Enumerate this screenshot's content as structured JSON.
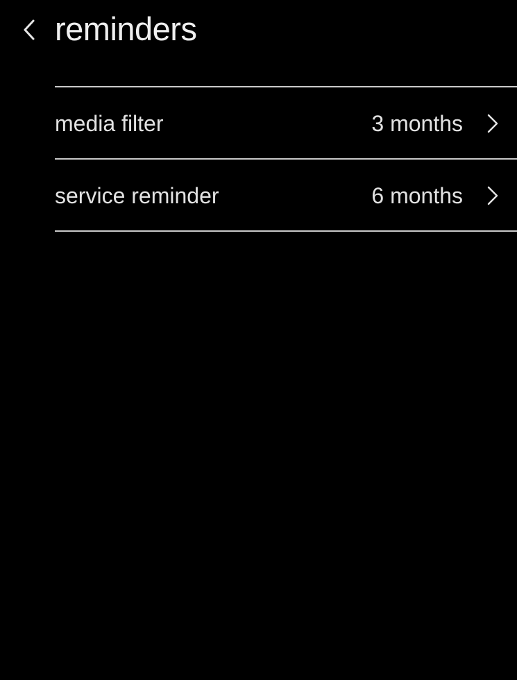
{
  "header": {
    "title": "reminders",
    "back_icon": "chevron-left-icon"
  },
  "reminders": {
    "items": [
      {
        "label": "media filter",
        "value": "3 months",
        "icon": "chevron-right-icon"
      },
      {
        "label": "service reminder",
        "value": "6 months",
        "icon": "chevron-right-icon"
      }
    ]
  },
  "colors": {
    "background": "#000000",
    "text": "#e2e2e2",
    "divider": "#c9c9c9"
  }
}
